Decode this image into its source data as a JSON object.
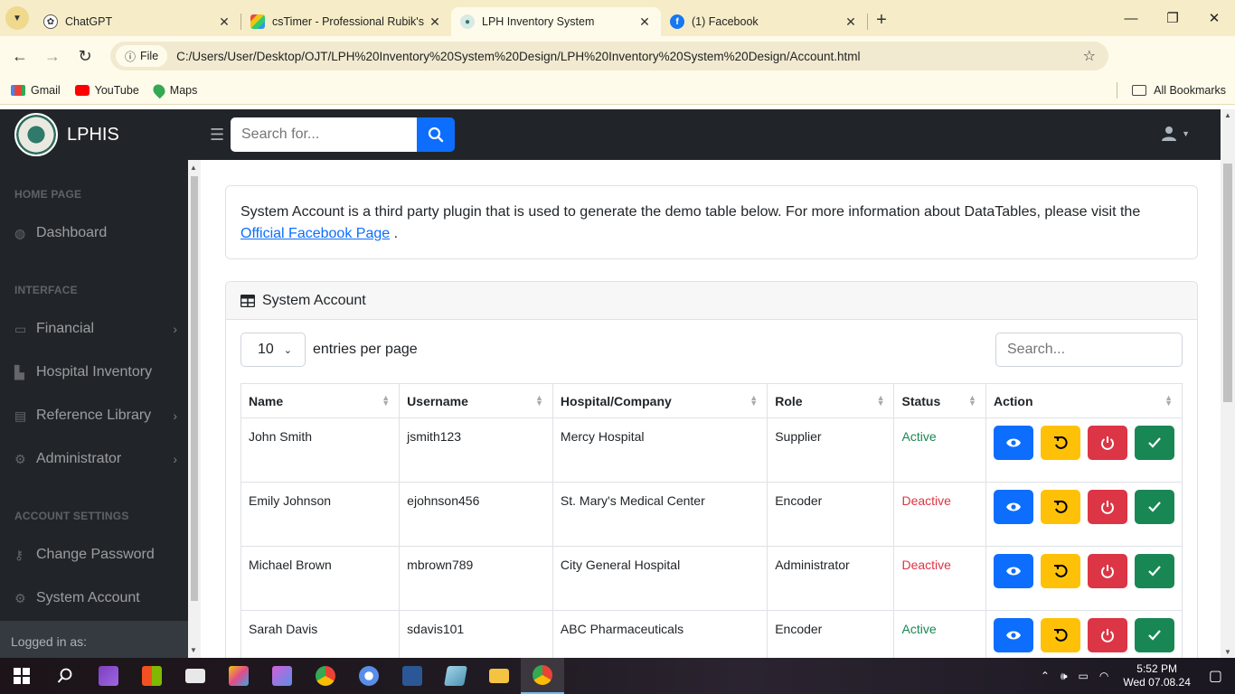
{
  "browser": {
    "tabs": [
      {
        "title": "ChatGPT",
        "color": "#444"
      },
      {
        "title": "csTimer - Professional Rubik's C",
        "color": "#c0392b"
      },
      {
        "title": "LPH Inventory System",
        "color": "#2f7a6a"
      },
      {
        "title": "(1) Facebook",
        "color": "#1877f2"
      }
    ],
    "url_chip": "File",
    "url": "C:/Users/User/Desktop/OJT/LPH%20Inventory%20System%20Design/LPH%20Inventory%20System%20Design/Account.html",
    "bookmarks": [
      "Gmail",
      "YouTube",
      "Maps"
    ],
    "all_bookmarks": "All Bookmarks"
  },
  "app": {
    "brand": "LPHIS",
    "search_placeholder": "Search for...",
    "sidebar": {
      "headings": [
        "HOME PAGE",
        "INTERFACE",
        "ACCOUNT SETTINGS"
      ],
      "items": [
        {
          "label": "Dashboard"
        },
        {
          "label": "Financial"
        },
        {
          "label": "Hospital Inventory"
        },
        {
          "label": "Reference Library"
        },
        {
          "label": "Administrator"
        },
        {
          "label": "Change Password"
        },
        {
          "label": "System Account"
        }
      ],
      "footer": "Logged in as:"
    },
    "info": {
      "text": "System Account is a third party plugin that is used to generate the demo table below. For more information about DataTables, please visit the",
      "link": "Official Facebook Page",
      "end": "."
    },
    "card": {
      "title": "System Account",
      "per_page_value": "10",
      "per_page_label": "entries per page",
      "search_placeholder": "Search...",
      "columns": [
        "Name",
        "Username",
        "Hospital/Company",
        "Role",
        "Status",
        "Action"
      ],
      "rows": [
        {
          "name": "John Smith",
          "username": "jsmith123",
          "company": "Mercy Hospital",
          "role": "Supplier",
          "status": "Active"
        },
        {
          "name": "Emily Johnson",
          "username": "ejohnson456",
          "company": "St. Mary's Medical Center",
          "role": "Encoder",
          "status": "Deactive"
        },
        {
          "name": "Michael Brown",
          "username": "mbrown789",
          "company": "City General Hospital",
          "role": "Administrator",
          "status": "Deactive"
        },
        {
          "name": "Sarah Davis",
          "username": "sdavis101",
          "company": "ABC Pharmaceuticals",
          "role": "Encoder",
          "status": "Active"
        }
      ]
    }
  },
  "taskbar": {
    "time": "5:52 PM",
    "date": "Wed 07.08.24"
  }
}
